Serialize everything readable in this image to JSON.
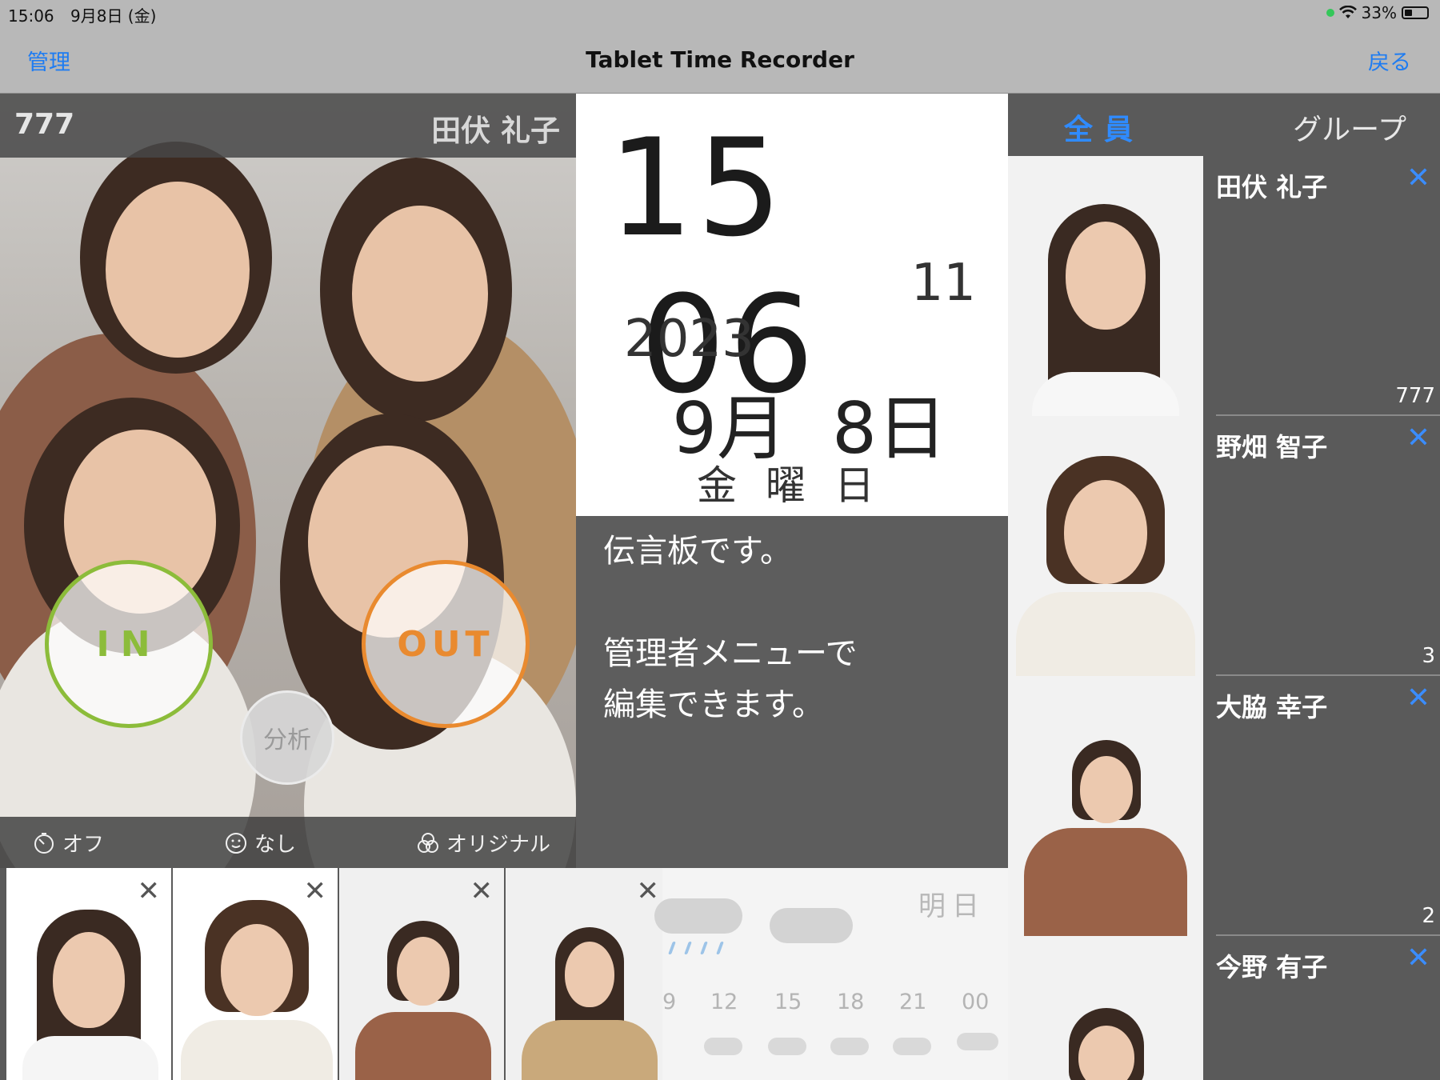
{
  "status_bar": {
    "time": "15:06",
    "date": "9月8日 (金)",
    "battery": "33%"
  },
  "nav": {
    "left_label": "管理",
    "title": "Tablet Time Recorder",
    "right_label": "戻る"
  },
  "photo_panel": {
    "employee_number": "777",
    "employee_name": "田伏 礼子",
    "in_label": "IN",
    "out_label": "OUT",
    "analysis_label": "分析",
    "toolbar": [
      {
        "icon": "timer-icon",
        "label": "オフ"
      },
      {
        "icon": "sticker-icon",
        "label": "なし"
      },
      {
        "icon": "filter-icon",
        "label": "オリジナル"
      }
    ]
  },
  "clock": {
    "hour": "15",
    "minute": "06",
    "second": "11",
    "year": "2023",
    "month": "9月",
    "day": "8日",
    "weekday": "金曜日"
  },
  "message_board": {
    "text": "伝言板です。\n\n管理者メニューで\n編集できます。"
  },
  "weather": {
    "label": "明日",
    "hours": [
      "9",
      "12",
      "15",
      "18",
      "21",
      "00"
    ]
  },
  "tabs": {
    "all": "全員",
    "group": "グループ"
  },
  "employees": [
    {
      "name": "田伏 礼子",
      "count": "777"
    },
    {
      "name": "野畑 智子",
      "count": "3"
    },
    {
      "name": "大脇 幸子",
      "count": "2"
    },
    {
      "name": "今野 有子",
      "count": ""
    }
  ]
}
